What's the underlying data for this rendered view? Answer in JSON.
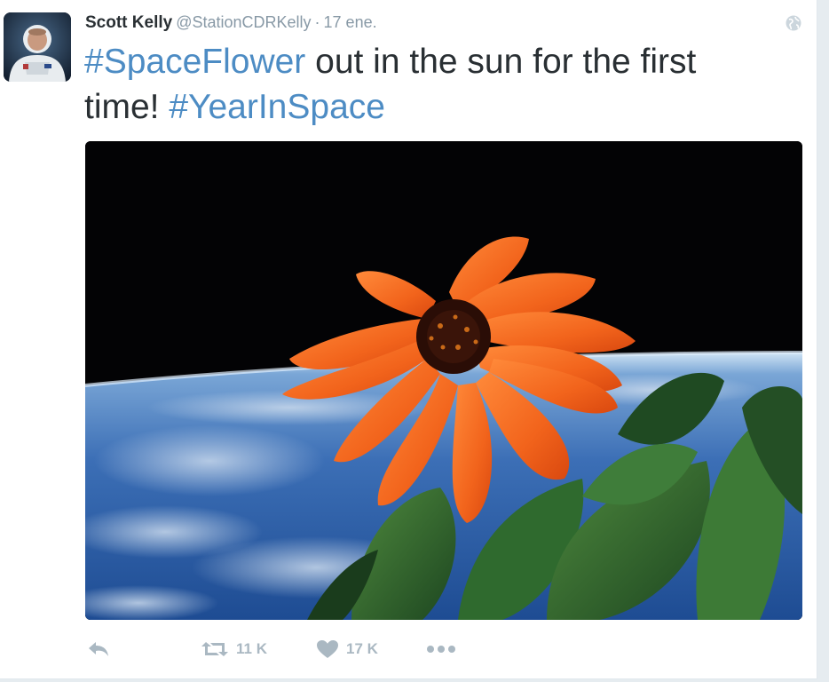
{
  "tweet": {
    "author": {
      "display_name": "Scott Kelly",
      "username": "@StationCDRKelly"
    },
    "separator": "·",
    "timestamp": "17 ene.",
    "text": {
      "hashtag_1": "#SpaceFlower",
      "segment_1": " out in the sun for the first time! ",
      "hashtag_2": "#YearInSpace"
    },
    "actions": {
      "reply_icon": "reply-icon",
      "retweet_icon": "retweet-icon",
      "retweet_count": "11 K",
      "like_icon": "heart-icon",
      "like_count": "17 K",
      "more_icon": "more-icon"
    }
  },
  "colors": {
    "hashtag": "#4d8cc4",
    "action_grey": "#aab8c2",
    "petal_orange": "#f06a1d"
  }
}
